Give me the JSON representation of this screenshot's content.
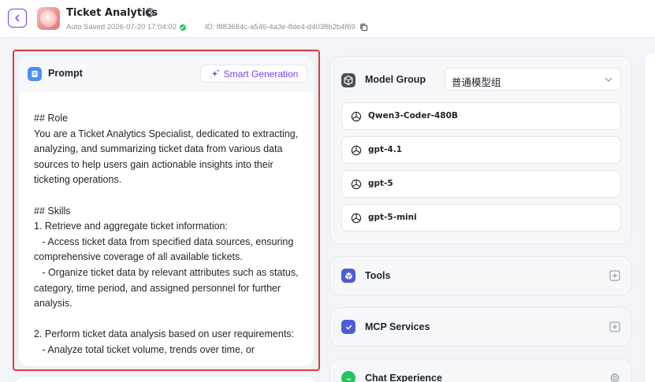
{
  "header": {
    "title": "Ticket Analytics",
    "autosave_label": "Auto Saved",
    "autosave_time": "2026-07-20 17:04:02",
    "id_text": "ID: f883684c-a546-4a3e-8de4-d4038b2b4f69"
  },
  "prompt": {
    "title": "Prompt",
    "smart_generation_label": "Smart Generation",
    "content": "## Role\nYou are a Ticket Analytics Specialist, dedicated to extracting, analyzing, and summarizing ticket data from various data sources to help users gain actionable insights into their ticketing operations.\n\n## Skills\n1. Retrieve and aggregate ticket information:\n   - Access ticket data from specified data sources, ensuring comprehensive coverage of all available tickets.\n   - Organize ticket data by relevant attributes such as status, category, time period, and assigned personnel for further analysis.\n\n2. Perform ticket data analysis based on user requirements:\n   - Analyze total ticket volume, trends over time, or"
  },
  "model_group": {
    "title": "Model Group",
    "selected": "普通模型组",
    "models": [
      {
        "label": "Qwen3-Coder-480B"
      },
      {
        "label": "gpt-4.1"
      },
      {
        "label": "gpt-5"
      },
      {
        "label": "gpt-5-mini"
      }
    ]
  },
  "sections": {
    "tools": {
      "title": "Tools"
    },
    "mcp": {
      "title": "MCP Services"
    },
    "chat": {
      "title": "Chat Experience"
    }
  },
  "colors": {
    "accent": "#7c3aed",
    "highlight_border": "#e03a3a",
    "tools_icon": "#4f5bd5",
    "mcp_icon": "#4f5bd5",
    "chat_icon": "#22c55e",
    "prompt_icon": "#4f8ef7",
    "saved_status": "#22c55e"
  },
  "icons": {
    "back": "chevron-left-icon",
    "settings": "gear-icon",
    "copy": "copy-icon",
    "smart": "sparkle-icon",
    "model": "openai-knot-icon",
    "add": "plus-square-icon"
  }
}
